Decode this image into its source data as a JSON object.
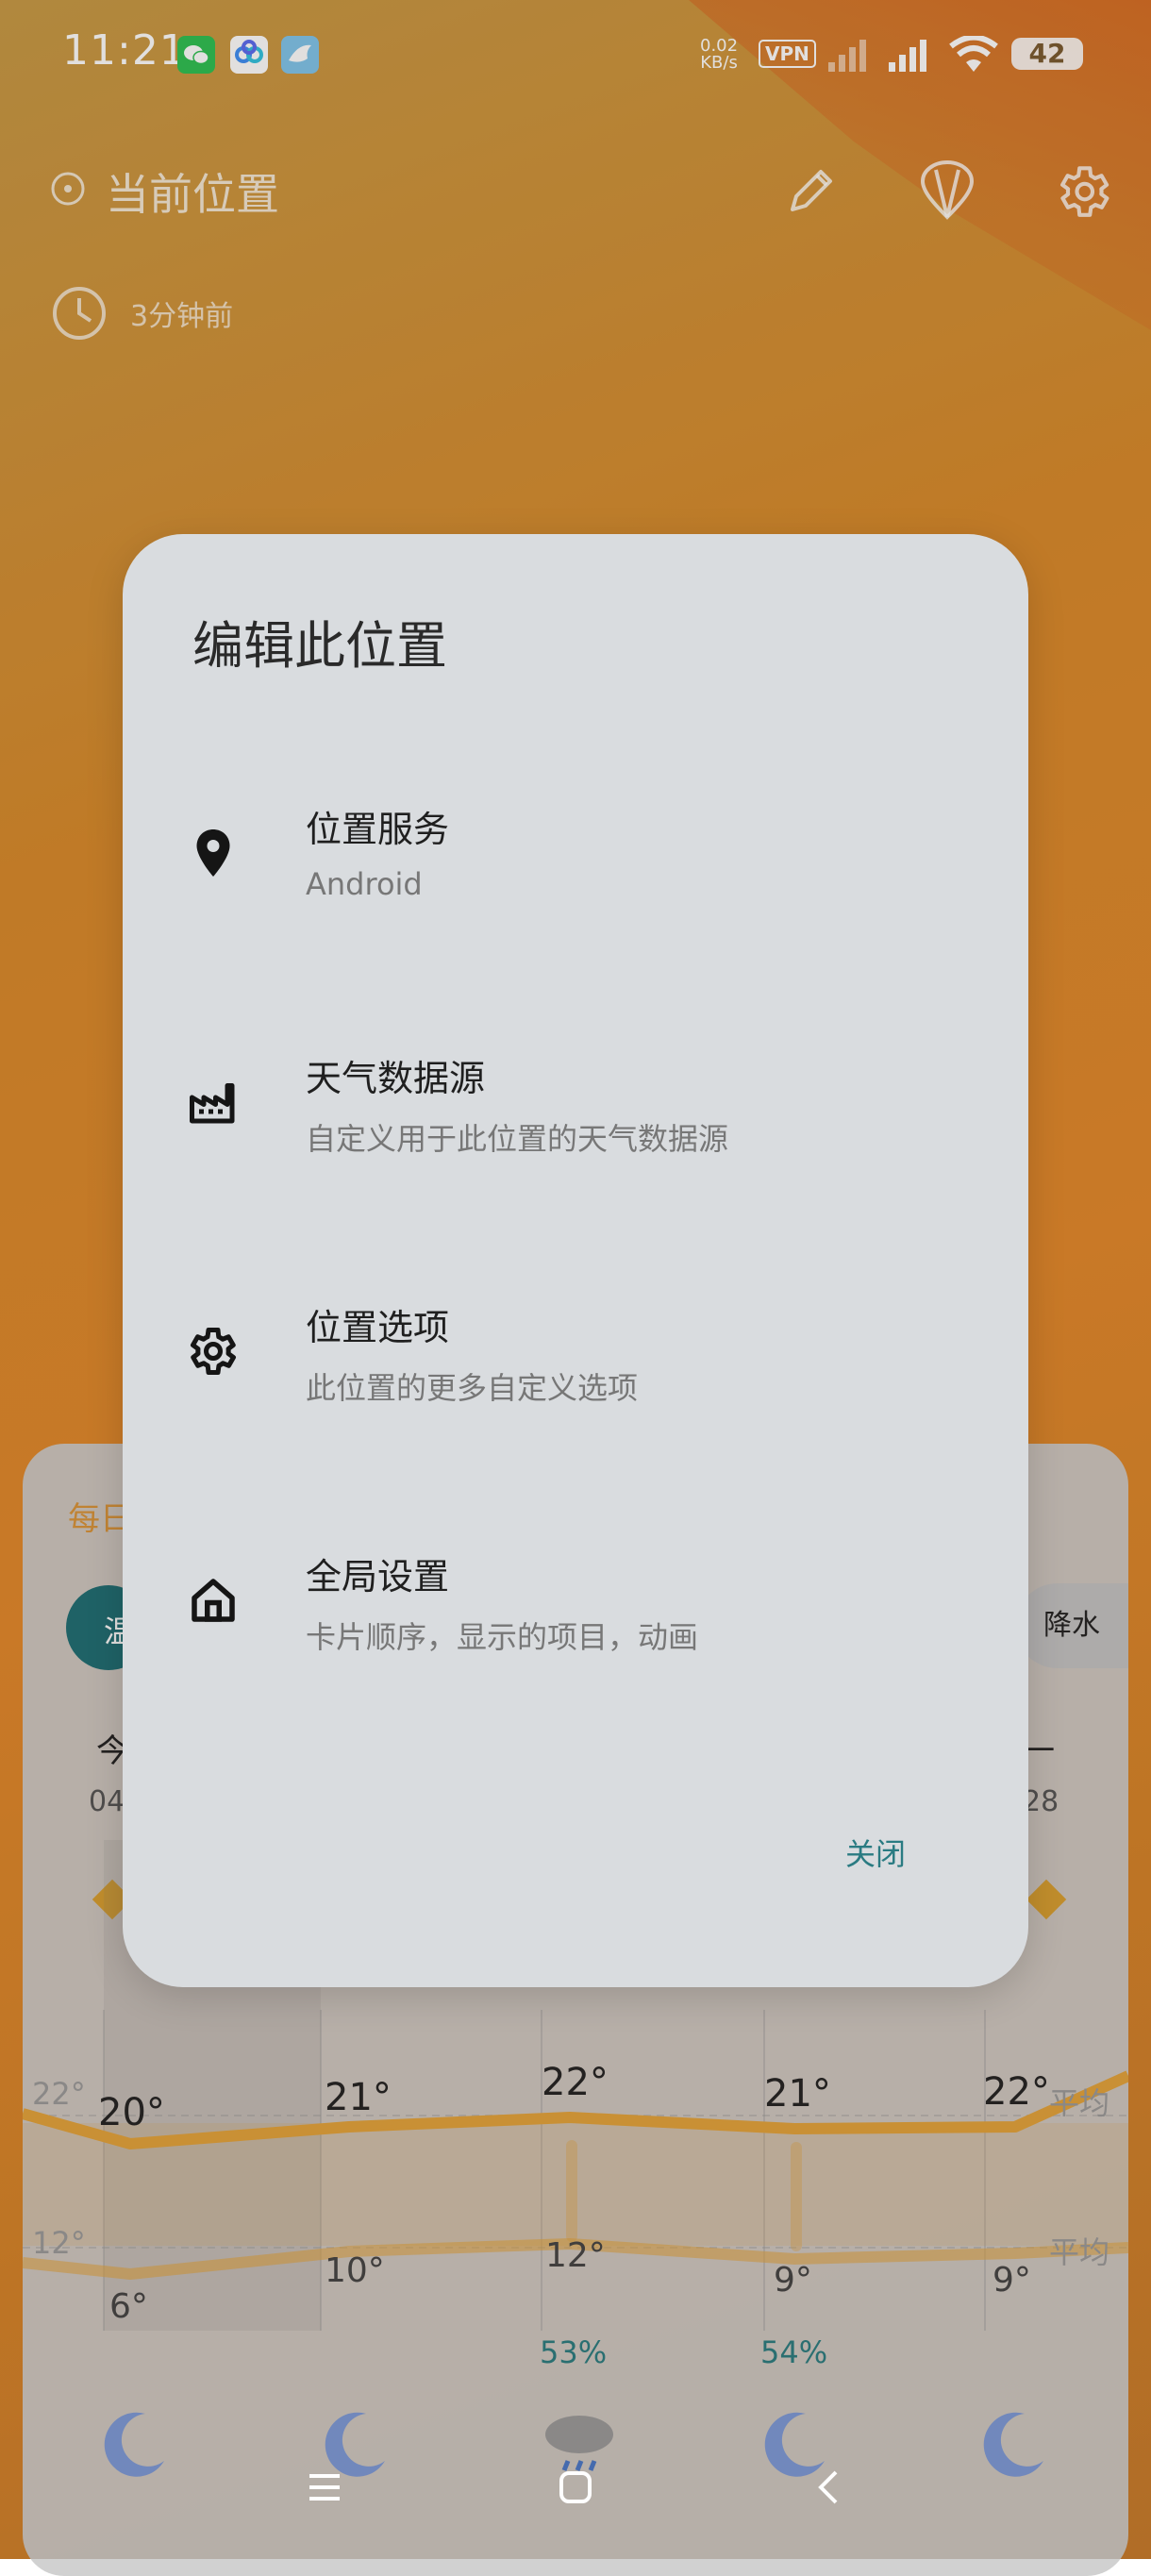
{
  "status_bar": {
    "time": "11:21",
    "net_speed_value": "0.02",
    "net_speed_unit": "KB/s",
    "vpn": "VPN",
    "battery": "42"
  },
  "header": {
    "location": "当前位置",
    "updated": "3分钟前"
  },
  "background_card": {
    "title_fragment": "每日",
    "chip_left_fragment": "温",
    "chip_right_label": "降水",
    "day_fragment": "今",
    "date_left_fragment": "04",
    "day_right_fragment": "一",
    "date_right_fragment": "28",
    "high_temps": [
      "20°",
      "21°",
      "22°",
      "21°",
      "22°"
    ],
    "low_temps": [
      "6°",
      "10°",
      "12°",
      "9°",
      "9°"
    ],
    "ref_high": "22°",
    "ref_low": "12°",
    "avg_label_1": "平均",
    "avg_label_2": "平均",
    "precip": [
      "53%",
      "54%"
    ]
  },
  "dialog": {
    "title": "编辑此位置",
    "items": [
      {
        "title": "位置服务",
        "subtitle": "Android",
        "icon": "location-pin-icon"
      },
      {
        "title": "天气数据源",
        "subtitle": "自定义用于此位置的天气数据源",
        "icon": "factory-icon"
      },
      {
        "title": "位置选项",
        "subtitle": "此位置的更多自定义选项",
        "icon": "gear-icon"
      },
      {
        "title": "全局设置",
        "subtitle": "卡片顺序，显示的项目，动画",
        "icon": "home-icon"
      }
    ],
    "close_label": "关闭"
  },
  "colors": {
    "accent": "#2a7b82",
    "chart_line": "#e3a43b",
    "dialog_bg": "#d9dcdf"
  }
}
